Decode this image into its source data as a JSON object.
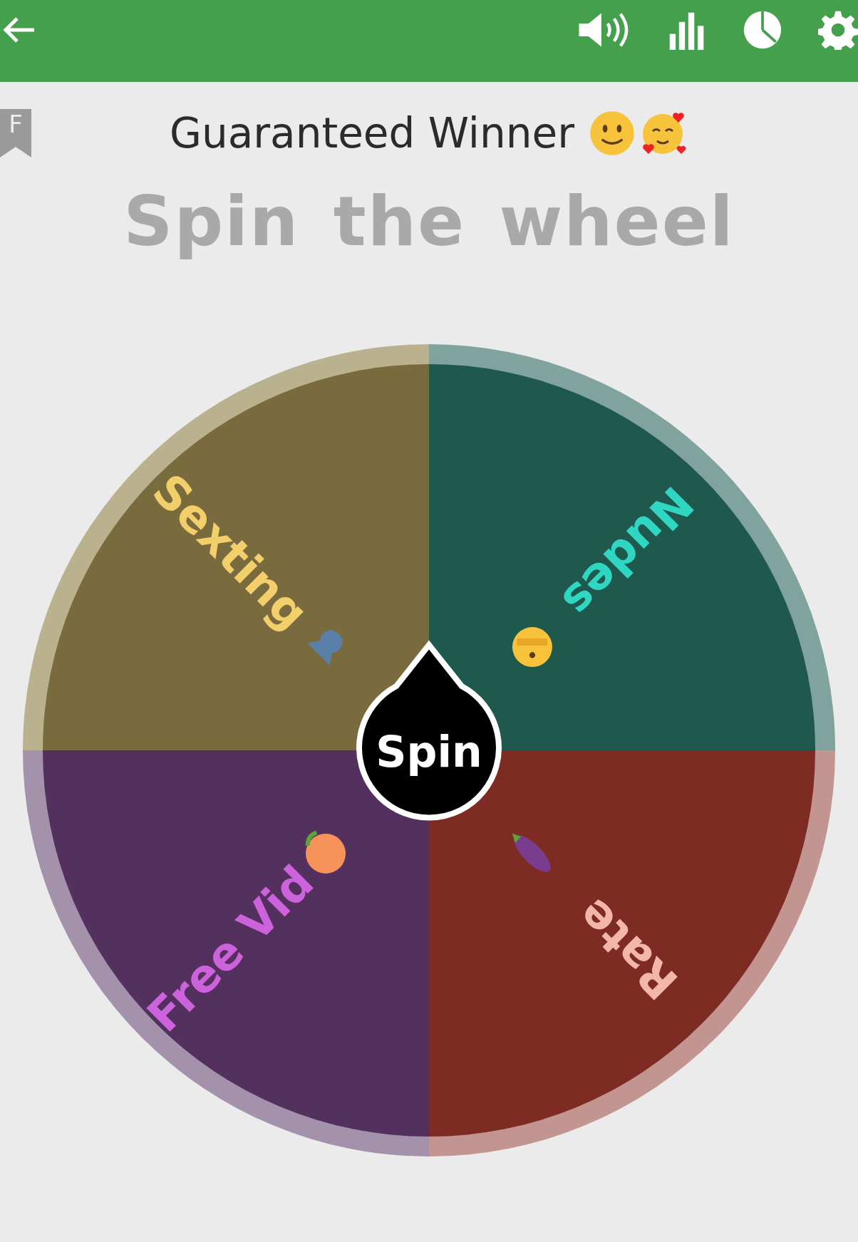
{
  "bookmark": {
    "label": "F"
  },
  "title": {
    "text": "Guaranteed Winner"
  },
  "heading": "Spin the wheel",
  "wheel": {
    "segments": [
      {
        "label": "Sexting",
        "color": "#7a6b3f"
      },
      {
        "label": "Nudes",
        "color": "#1f584d"
      },
      {
        "label": "Rate",
        "color": "#7e2b24"
      },
      {
        "label": "Free Vid",
        "color": "#54305e"
      }
    ],
    "button": "Spin"
  }
}
